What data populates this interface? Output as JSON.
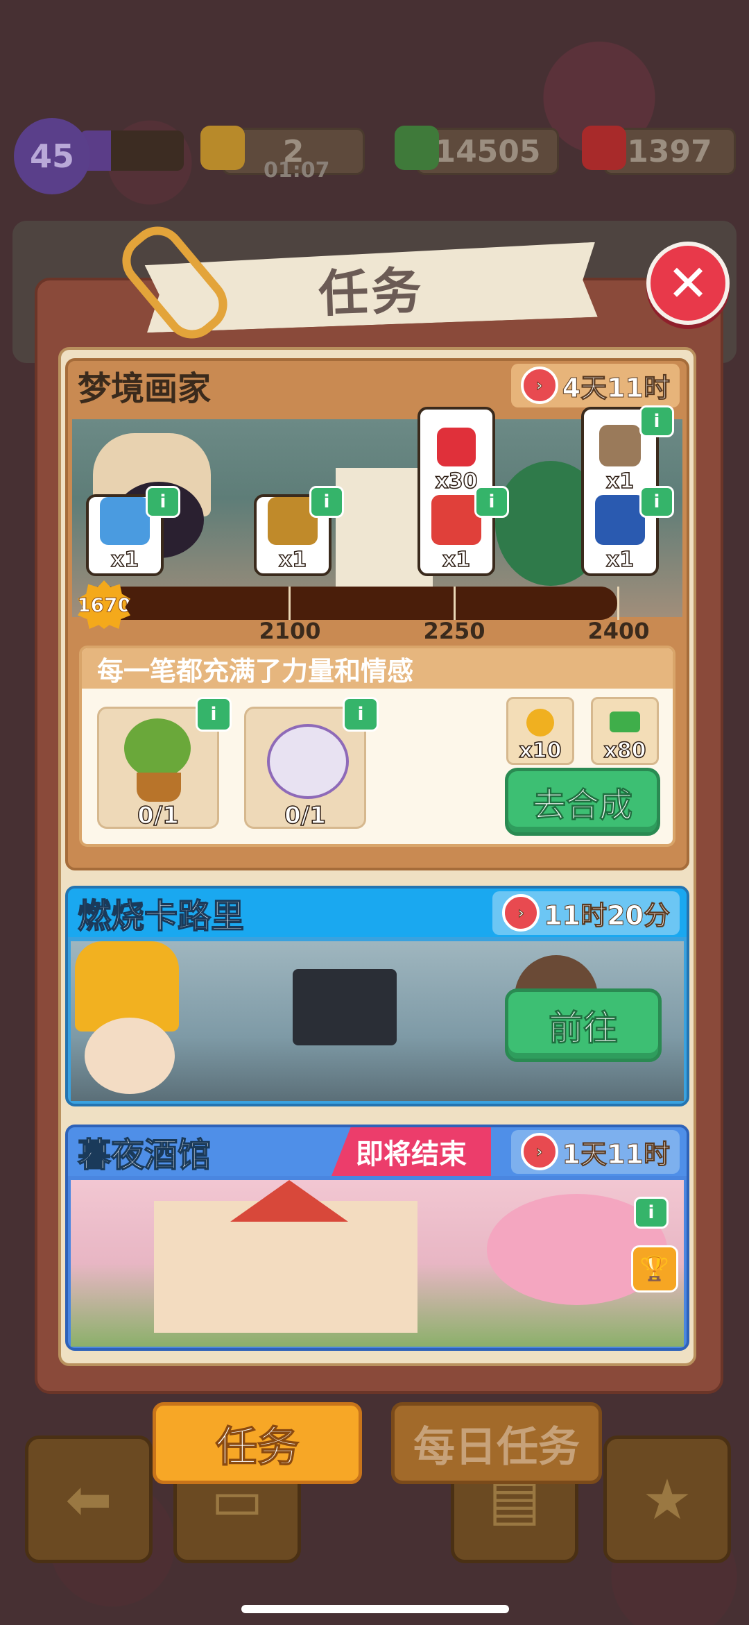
{
  "status_bar": {
    "level": "45",
    "energy": "2",
    "energy_timer": "01:07",
    "cash": "14505",
    "gems": "1397"
  },
  "dialog": {
    "title": "任务",
    "close_glyph": "✕"
  },
  "event1": {
    "name": "梦境画家",
    "time_left": "4天11时",
    "current_points": "1670",
    "milestones": [
      "2100",
      "2250",
      "2400"
    ],
    "rewards": [
      {
        "count": "x1",
        "icon": "hourglass-icon",
        "color": "#4a9be0"
      },
      {
        "count": "x1",
        "icon": "treasure-chest-icon",
        "color": "#c08a2a"
      },
      {
        "count": "x30",
        "icon": "ruby-icon",
        "color": "#e0303a"
      },
      {
        "count": "x1",
        "icon": "red-envelope-icon",
        "color": "#e0403a"
      },
      {
        "count": "x1",
        "icon": "character-icon",
        "color": "#9a7a5a"
      },
      {
        "count": "x1",
        "icon": "jewel-chest-icon",
        "color": "#2a5ab0"
      }
    ],
    "task_title": "每一笔都充满了力量和情感",
    "requirements": [
      {
        "count": "0/1",
        "icon": "potted-tree-icon"
      },
      {
        "count": "0/1",
        "icon": "cotton-flower-icon"
      }
    ],
    "task_rewards": [
      {
        "count": "x10",
        "icon": "gold-flower-icon"
      },
      {
        "count": "x80",
        "icon": "cash-icon"
      }
    ],
    "action_label": "去合成",
    "info_glyph": "i"
  },
  "event2": {
    "name": "燃烧卡路里",
    "time_left": "11时20分",
    "action_label": "前往"
  },
  "event3": {
    "name": "暮夜酒馆",
    "tag": "即将结束",
    "time_left": "1天11时"
  },
  "tabs": {
    "active": "任务",
    "inactive": "每日任务"
  }
}
